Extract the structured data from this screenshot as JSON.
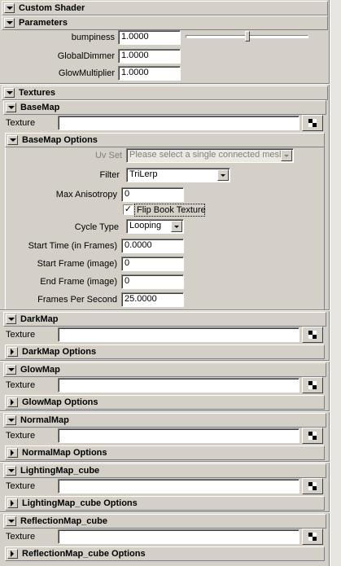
{
  "custom_shader": {
    "title": "Custom Shader"
  },
  "parameters": {
    "title": "Parameters",
    "rows": [
      {
        "label": "bumpiness",
        "value": "1.0000"
      },
      {
        "label": "GlobalDimmer",
        "value": "1.0000"
      },
      {
        "label": "GlowMultiplier",
        "value": "1.0000"
      }
    ],
    "bumpiness_slider_fraction": 0.5
  },
  "textures": {
    "title": "Textures"
  },
  "texture_label": "Texture",
  "basemap": {
    "title": "BaseMap",
    "options_title": "BaseMap Options",
    "uv_set_label": "Uv Set",
    "uv_set_value": "Please select a single connected mesh",
    "filter_label": "Filter",
    "filter_value": "TriLerp",
    "max_anisotropy_label": "Max Anisotropy",
    "max_anisotropy_value": "0",
    "flipbook_label": "Flip Book Texture",
    "flipbook_checked": "✓",
    "cycle_type_label": "Cycle Type",
    "cycle_type_value": "Looping",
    "start_time_label": "Start Time (in Frames)",
    "start_time_value": "0.0000",
    "start_frame_label": "Start Frame (image)",
    "start_frame_value": "0",
    "end_frame_label": "End Frame (image)",
    "end_frame_value": "0",
    "fps_label": "Frames Per Second",
    "fps_value": "25.0000"
  },
  "darkmap": {
    "title": "DarkMap",
    "options_title": "DarkMap Options"
  },
  "glowmap": {
    "title": "GlowMap",
    "options_title": "GlowMap Options"
  },
  "normalmap": {
    "title": "NormalMap",
    "options_title": "NormalMap Options"
  },
  "lightingmap": {
    "title": "LightingMap_cube",
    "options_title": "LightingMap_cube Options"
  },
  "reflectionmap": {
    "title": "ReflectionMap_cube",
    "options_title": "ReflectionMap_cube Options"
  },
  "icons": {
    "collapse": "triangle-down-icon",
    "expand": "triangle-right-icon",
    "map": "checker-map-icon"
  }
}
